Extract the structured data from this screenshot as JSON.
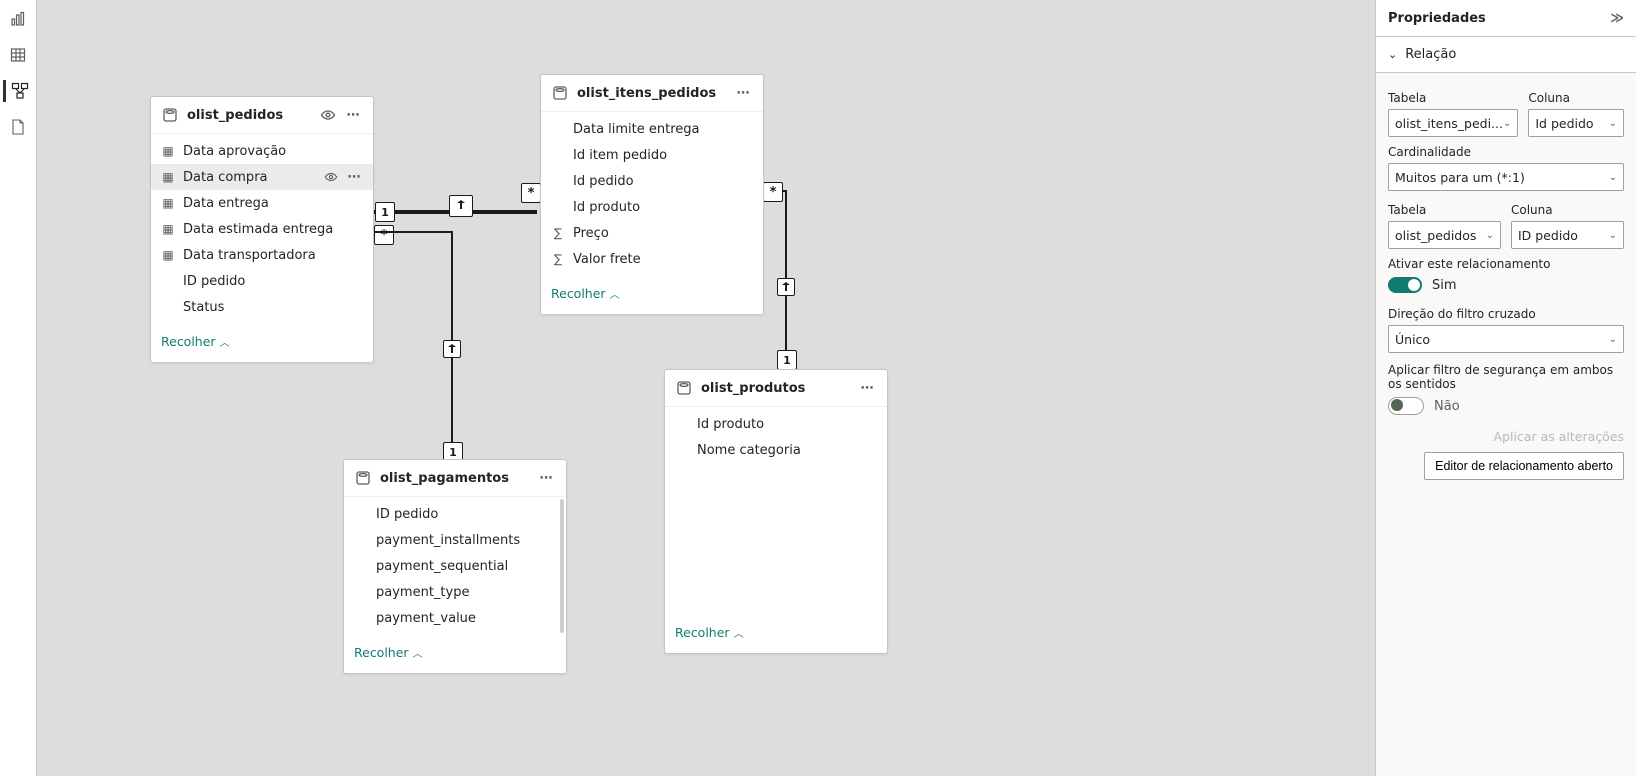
{
  "rail": {
    "items": [
      "report",
      "data",
      "model",
      "dax"
    ],
    "active": 2
  },
  "cards": {
    "pedidos": {
      "title": "olist_pedidos",
      "fields": [
        {
          "icon": "cal",
          "label": "Data aprovação"
        },
        {
          "icon": "cal",
          "label": "Data compra",
          "selected": true
        },
        {
          "icon": "cal",
          "label": "Data entrega"
        },
        {
          "icon": "cal",
          "label": "Data estimada entrega"
        },
        {
          "icon": "cal",
          "label": "Data transportadora"
        },
        {
          "icon": "",
          "label": "ID pedido"
        },
        {
          "icon": "",
          "label": "Status"
        }
      ],
      "collapse": "Recolher"
    },
    "itens": {
      "title": "olist_itens_pedidos",
      "fields": [
        {
          "icon": "",
          "label": "Data limite entrega"
        },
        {
          "icon": "",
          "label": "Id item pedido"
        },
        {
          "icon": "",
          "label": "Id pedido"
        },
        {
          "icon": "",
          "label": "Id produto"
        },
        {
          "icon": "sum",
          "label": "Preço"
        },
        {
          "icon": "sum",
          "label": "Valor frete"
        }
      ],
      "collapse": "Recolher"
    },
    "produtos": {
      "title": "olist_produtos",
      "fields": [
        {
          "icon": "",
          "label": "Id produto"
        },
        {
          "icon": "",
          "label": "Nome categoria"
        }
      ],
      "collapse": "Recolher"
    },
    "pagamentos": {
      "title": "olist_pagamentos",
      "fields": [
        {
          "icon": "",
          "label": "ID pedido"
        },
        {
          "icon": "",
          "label": "payment_installments"
        },
        {
          "icon": "",
          "label": "payment_sequential"
        },
        {
          "icon": "",
          "label": "payment_type"
        },
        {
          "icon": "",
          "label": "payment_value"
        }
      ],
      "collapse": "Recolher"
    }
  },
  "panel": {
    "title": "Propriedades",
    "section": "Relação",
    "table_label": "Tabela",
    "column_label": "Coluna",
    "cardinality_label": "Cardinalidade",
    "activate_label": "Ativar este relacionamento",
    "crossfilter_label": "Direção do filtro cruzado",
    "security_label": "Aplicar filtro de segurança em ambos os sentidos",
    "apply_link": "Aplicar as alterações",
    "editor_btn": "Editor de relacionamento aberto",
    "yes": "Sim",
    "no": "Não",
    "table1": "olist_itens_pedi...",
    "column1": "Id pedido",
    "cardinality": "Muitos para um (*:1)",
    "table2": "olist_pedidos",
    "column2": "ID pedido",
    "crossfilter": "Único"
  }
}
